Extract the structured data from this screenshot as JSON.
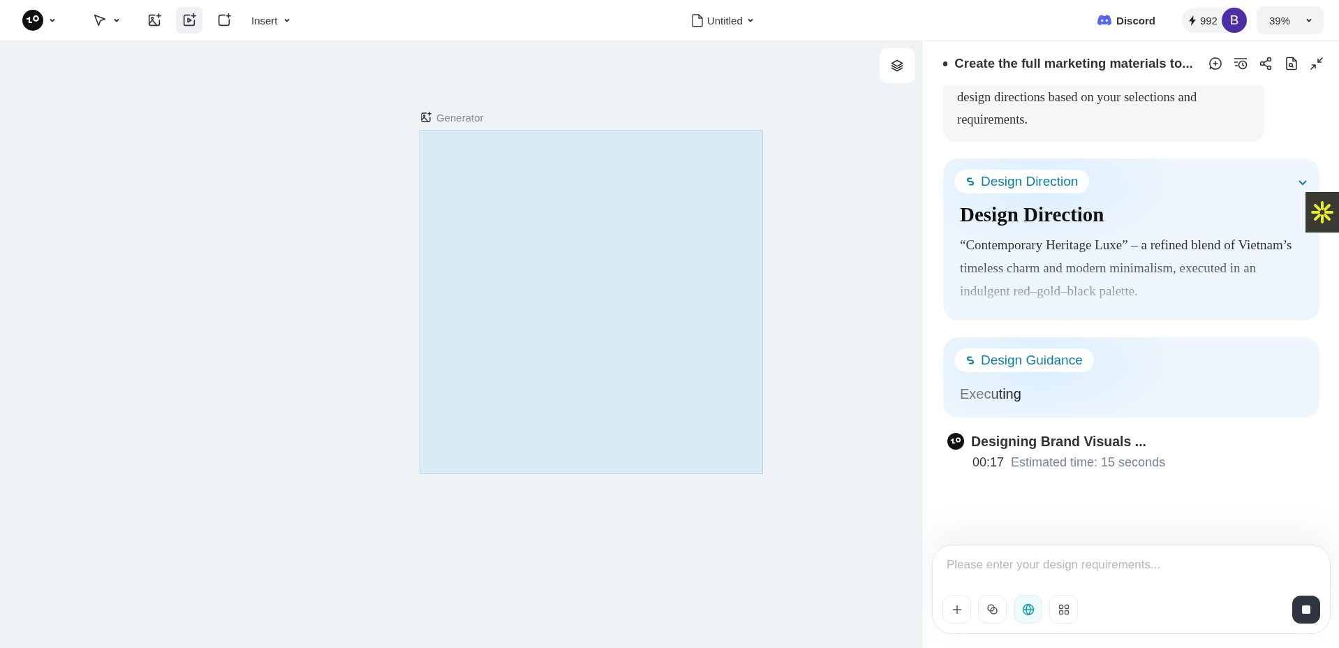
{
  "topbar": {
    "tools": [
      {
        "kind": "logo",
        "selected": false
      },
      {
        "kind": "pointer",
        "selected": false
      },
      {
        "kind": "image",
        "selected": false
      },
      {
        "kind": "video",
        "selected": true
      },
      {
        "kind": "frame",
        "selected": false
      }
    ],
    "insert_menu": "Insert",
    "document_title": "Untitled",
    "discord": "Discord",
    "credits": "992",
    "avatar": "B",
    "zoom": "39%"
  },
  "canvas": {
    "frame_label": "Generator"
  },
  "chat": {
    "title": "Create the full marketing materials to...",
    "messages": [
      {
        "kind": "bubble",
        "text": "design directions based on your selections and requirements."
      },
      {
        "kind": "direction",
        "label": "Design Direction",
        "heading": "Design Direction",
        "body": "“Contemporary Heritage Luxe” – a refined blend of Vietnam’s timeless charm and modern minimalism, executed in an indulgent red–gold–black palette."
      },
      {
        "kind": "guidance",
        "label": "Design Guidance",
        "status": "Executing"
      },
      {
        "kind": "progress",
        "title": "Designing Brand Visuals ...",
        "elapsed": "00:17",
        "estimate": "Estimated time: 15 seconds"
      }
    ],
    "input": {
      "placeholder": "Please enter your design requirements...",
      "buttons": [
        {
          "kind": "add",
          "selected": false
        },
        {
          "kind": "link",
          "selected": false
        },
        {
          "kind": "web",
          "selected": true
        },
        {
          "kind": "apps",
          "selected": false
        }
      ]
    }
  }
}
